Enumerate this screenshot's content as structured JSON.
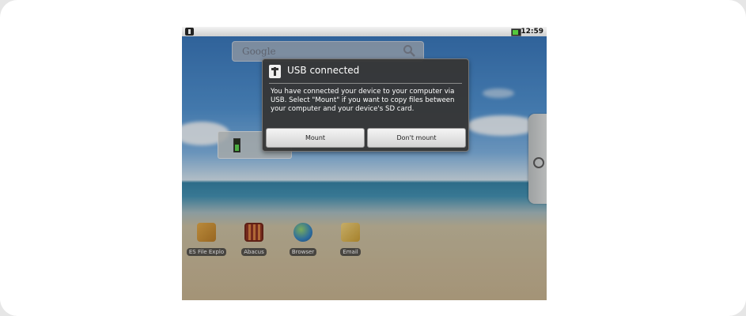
{
  "status_bar": {
    "time": "12:59",
    "usb_icon": "usb-icon",
    "battery_icon": "battery-icon"
  },
  "search_widget": {
    "label": "Google",
    "icon": "search-icon"
  },
  "dialog": {
    "title": "USB connected",
    "message": "You have connected your device to your computer via USB. Select \"Mount\" if you want to copy files between your computer and your device's SD card.",
    "mount_label": "Mount",
    "dont_mount_label": "Don't mount"
  },
  "apps": [
    {
      "label": "ES File Explo",
      "icon": "folder-icon"
    },
    {
      "label": "Abacus",
      "icon": "abacus-icon"
    },
    {
      "label": "Browser",
      "icon": "globe-icon"
    },
    {
      "label": "Email",
      "icon": "email-icon"
    }
  ]
}
